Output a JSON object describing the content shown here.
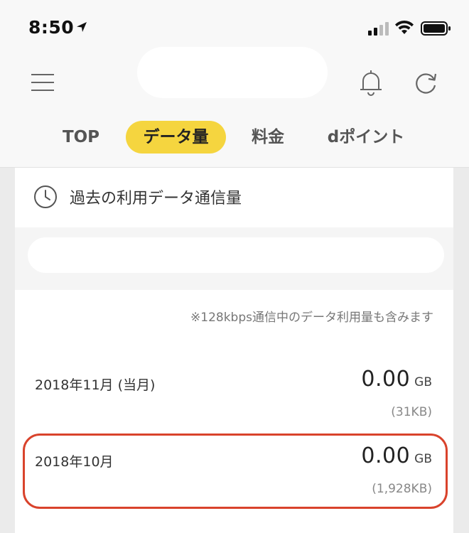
{
  "status_bar": {
    "time": "8:50",
    "icons": [
      "location-arrow-icon",
      "cellular-signal-icon",
      "wifi-icon",
      "battery-icon"
    ]
  },
  "header": {
    "icons": [
      "hamburger-menu-icon",
      "bell-icon",
      "refresh-icon"
    ],
    "tabs": [
      {
        "label": "TOP",
        "active": false
      },
      {
        "label": "データ量",
        "active": true
      },
      {
        "label": "料金",
        "active": false
      },
      {
        "label": "dポイント",
        "active": false
      }
    ]
  },
  "card": {
    "title": "過去の利用データ通信量",
    "title_icon": "clock-icon",
    "note": "※128kbps通信中のデータ利用量も含みます",
    "rows": [
      {
        "month": "2018年11月 (当月)",
        "value": "0.00",
        "unit": "GB",
        "kb": "(31KB)"
      },
      {
        "month": "2018年10月",
        "value": "0.00",
        "unit": "GB",
        "kb": "(1,928KB)",
        "highlighted": true
      }
    ]
  },
  "colors": {
    "accent_yellow": "#f5d53f",
    "highlight_red": "#d9432c",
    "background": "#ebebeb"
  }
}
